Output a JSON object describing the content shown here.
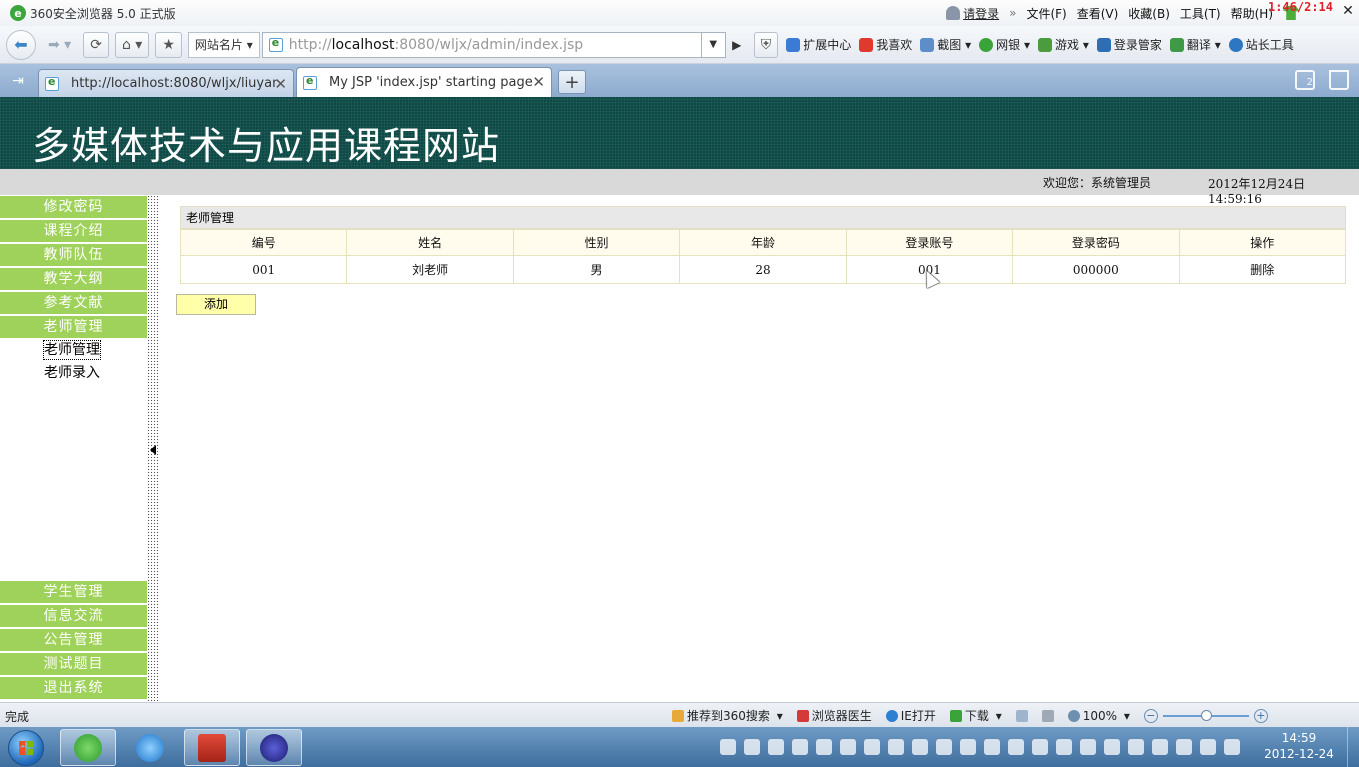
{
  "browser": {
    "app_title": "360安全浏览器 5.0 正式版",
    "login_label": "请登录",
    "menus": [
      "文件(F)",
      "查看(V)",
      "收藏(B)",
      "工具(T)",
      "帮助(H)"
    ],
    "timer": "1:46/2:14",
    "namecard_label": "网站名片",
    "url_prefix": "http://",
    "url_host": "localhost",
    "url_rest": ":8080/wljx/admin/index.jsp",
    "extensions": [
      "扩展中心",
      "我喜欢",
      "截图",
      "网银",
      "游戏",
      "登录管家",
      "翻译",
      "站长工具"
    ],
    "tabs": [
      {
        "label": "http://localhost:8080/wljx/liuyanAll..."
      },
      {
        "label": "My JSP 'index.jsp' starting page"
      }
    ],
    "tab_count": "2"
  },
  "page": {
    "site_title": "多媒体技术与应用课程网站",
    "welcome": "欢迎您：系统管理员",
    "datetime": "2012年12月24日  14:59:16",
    "nav_top": [
      "修改密码",
      "课程介绍",
      "教师队伍",
      "教学大纲",
      "参考文献",
      "老师管理"
    ],
    "nav_sub": [
      "老师管理",
      "老师录入"
    ],
    "nav_bottom": [
      "学生管理",
      "信息交流",
      "公告管理",
      "测试题目",
      "退出系统"
    ],
    "panel_title": "老师管理",
    "columns": [
      "编号",
      "姓名",
      "性别",
      "年龄",
      "登录账号",
      "登录密码",
      "操作"
    ],
    "rows": [
      {
        "id": "001",
        "name": "刘老师",
        "gender": "男",
        "age": "28",
        "account": "001",
        "password": "000000",
        "action": "删除"
      }
    ],
    "add_button": "添加"
  },
  "statusbar": {
    "status": "完成",
    "recommend": "推荐到360搜索",
    "doctor": "浏览器医生",
    "ie_open": "IE打开",
    "download": "下载",
    "zoom": "100%",
    "zoom_level_percent": 100
  },
  "taskbar": {
    "time": "14:59",
    "date": "2012-12-24"
  },
  "colors": {
    "banner": "#0d4a46",
    "nav_green": "#9fd25a",
    "add_button": "#ffffaa",
    "timer": "#e0202a"
  }
}
